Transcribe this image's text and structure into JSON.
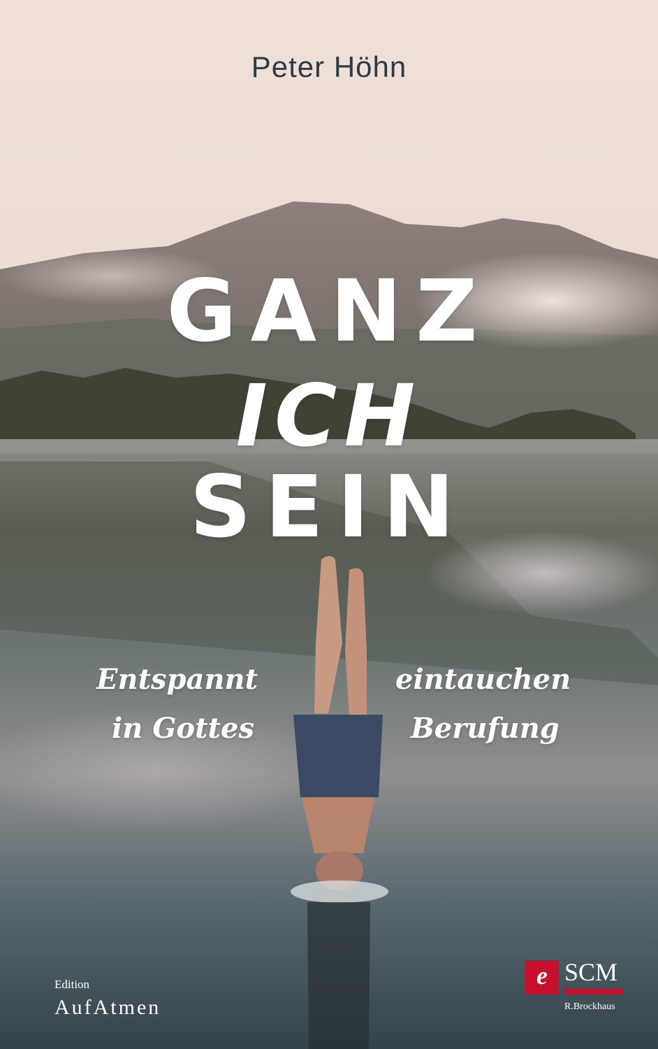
{
  "cover": {
    "author": "Peter Höhn",
    "title_lines": [
      "GANZ",
      "ICH",
      "SEIN"
    ],
    "subtitle": {
      "left_top": "Entspannt",
      "left_bottom": "in Gottes",
      "right_top": "eintauchen",
      "right_bottom": "Berufung"
    },
    "edition": {
      "small": "Edition",
      "big": "AufAtmen"
    },
    "publisher": {
      "mark": "e",
      "name": "SCM",
      "sub": "R.Brockhaus"
    },
    "colors": {
      "brand_red": "#c8102e",
      "sky": "#ead9d1",
      "water": "#4a585e",
      "author": "#2c3b45"
    }
  }
}
